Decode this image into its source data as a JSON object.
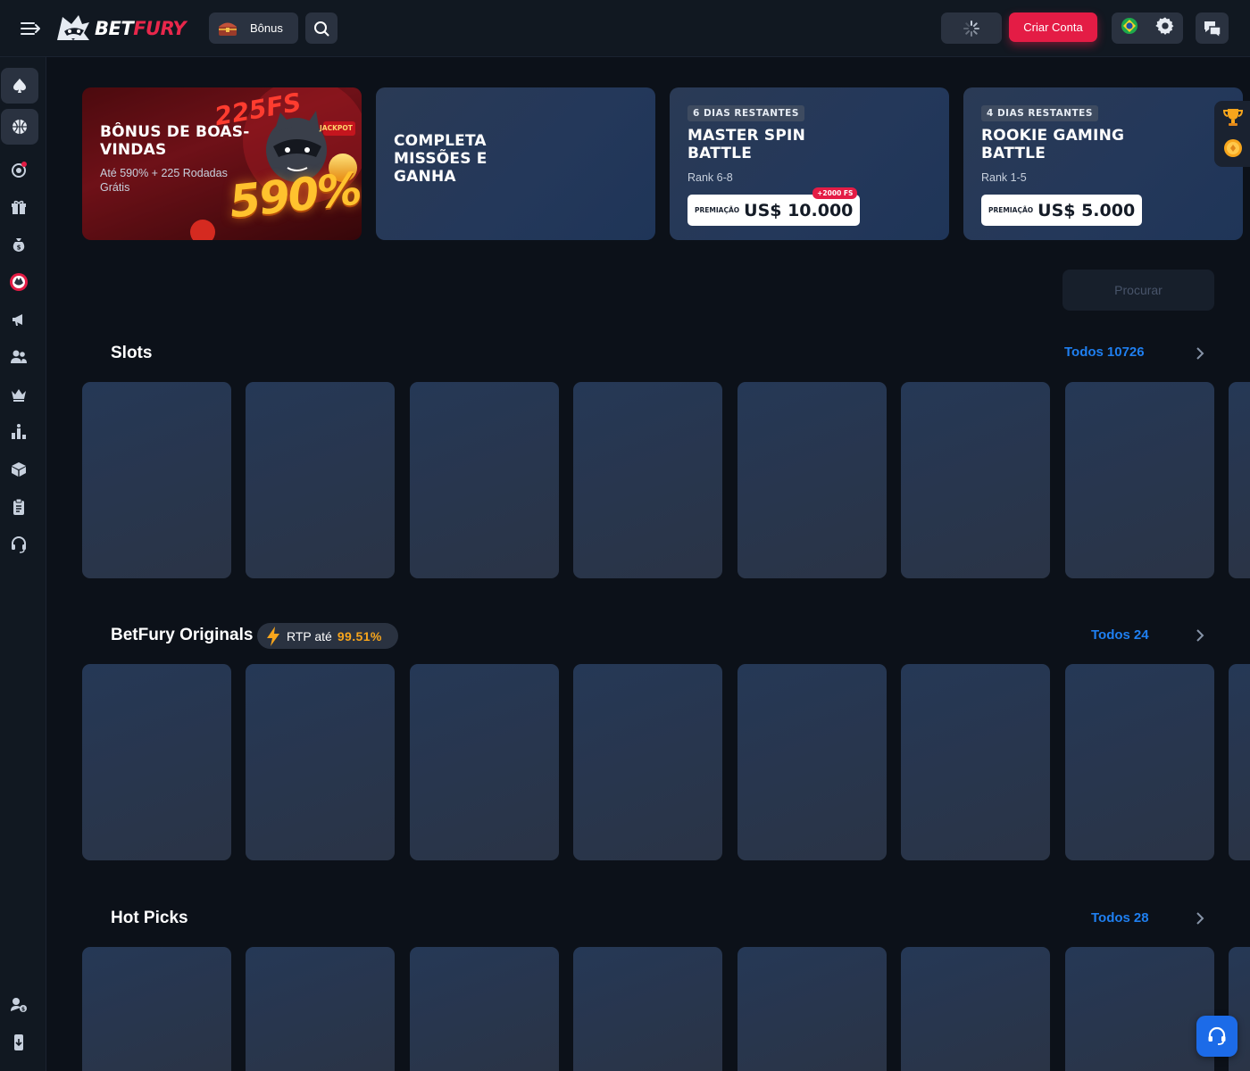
{
  "header": {
    "logo": {
      "bet": "BET",
      "fury": "FURY"
    },
    "bonus_label": "Bônus",
    "signup_label": "Criar Conta",
    "icons": [
      "menu-icon",
      "raccoon-logo-icon",
      "chest-icon",
      "search-icon",
      "spinner-icon",
      "brazil-flag-icon",
      "gear-icon",
      "chat-icon"
    ]
  },
  "sidebar": {
    "items": [
      "casino",
      "sports",
      "target",
      "gift",
      "money-bag",
      "bf-token",
      "promo",
      "referral",
      "vip",
      "leaderboard",
      "box",
      "clipboard",
      "support",
      "wallet",
      "mobile"
    ]
  },
  "banners": [
    {
      "title": "BÔNUS DE BOAS-VINDAS",
      "subtitle": "Até 590% + 225 Rodadas Grátis",
      "art_text_big": "590%",
      "art_text_fs": "225FS",
      "art_text_jackpot": "JACKPOT"
    },
    {
      "title": "COMPLETA MISSÕES E GANHA"
    },
    {
      "tag": "6 DIAS RESTANTES",
      "title": "MASTER SPIN BATTLE",
      "rank": "Rank 6-8",
      "prize_label": "PREMIAÇÃO",
      "prize_value": "US$ 10.000",
      "badge": "+2000 FS"
    },
    {
      "tag": "4 DIAS RESTANTES",
      "title": "ROOKIE GAMING BATTLE",
      "rank": "Rank 1-5",
      "prize_label": "PREMIAÇÃO",
      "prize_value": "US$ 5.000"
    }
  ],
  "search": {
    "placeholder": "Procurar"
  },
  "sections": [
    {
      "title": "Slots",
      "see_all": "Todos",
      "count": "10726"
    },
    {
      "title": "BetFury Originals",
      "see_all": "Todos",
      "count": "24",
      "rtp_label": "RTP até",
      "rtp_value": "99.51%"
    },
    {
      "title": "Hot Picks",
      "see_all": "Todos",
      "count": "28"
    }
  ],
  "colors": {
    "accent": "#e41c45",
    "link": "#1f7ff0",
    "rtp": "#f7a51c",
    "bg": "#0c1119",
    "panel": "#111821"
  }
}
